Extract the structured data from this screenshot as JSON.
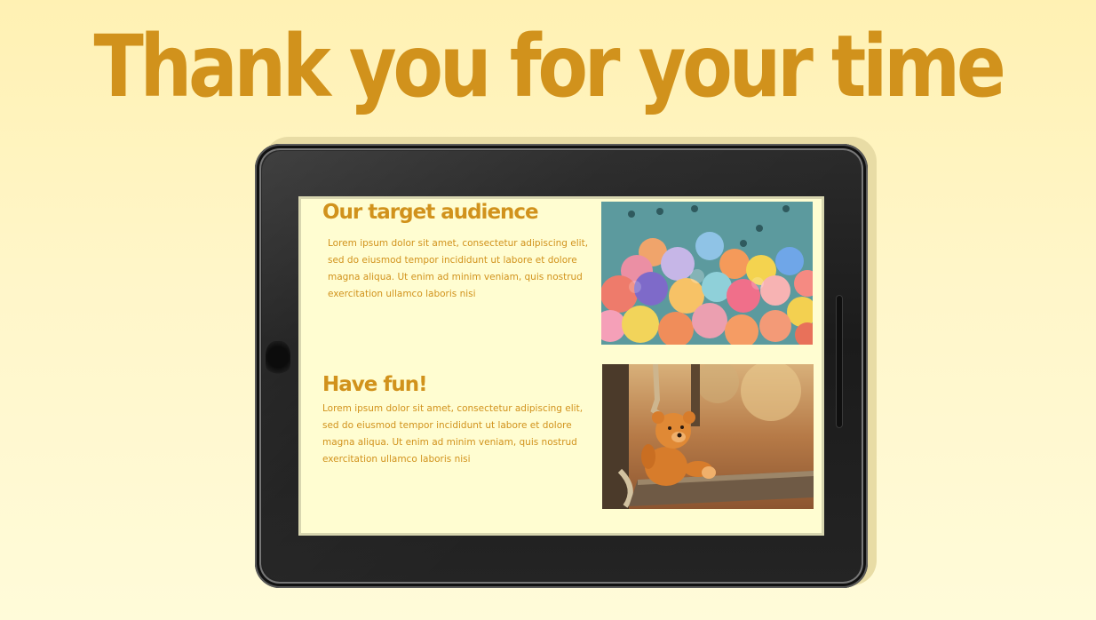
{
  "slide": {
    "title": "Thank you for your time"
  },
  "sections": [
    {
      "heading": "Our target audience",
      "body": "Lorem ipsum dolor sit amet, consectetur adipiscing elit, sed do eiusmod tempor incididunt ut labore et dolore magna aliqua. Ut enim ad minim veniam, quis nostrud exercitation ullamco laboris nisi"
    },
    {
      "heading": "Have fun!",
      "body": "Lorem ipsum dolor sit amet, consectetur adipiscing elit, sed do eiusmod tempor incididunt ut labore et dolore magna aliqua. Ut enim ad minim veniam, quis nostrud exercitation ullamco laboris nisi"
    }
  ],
  "images": {
    "ball_pit": "ball-pit-photo",
    "teddy_bear": "teddy-bear-swing-photo"
  },
  "colors": {
    "accent": "#d1921c",
    "screen_background": "#fffdd1",
    "page_background": "#fff4c2"
  }
}
